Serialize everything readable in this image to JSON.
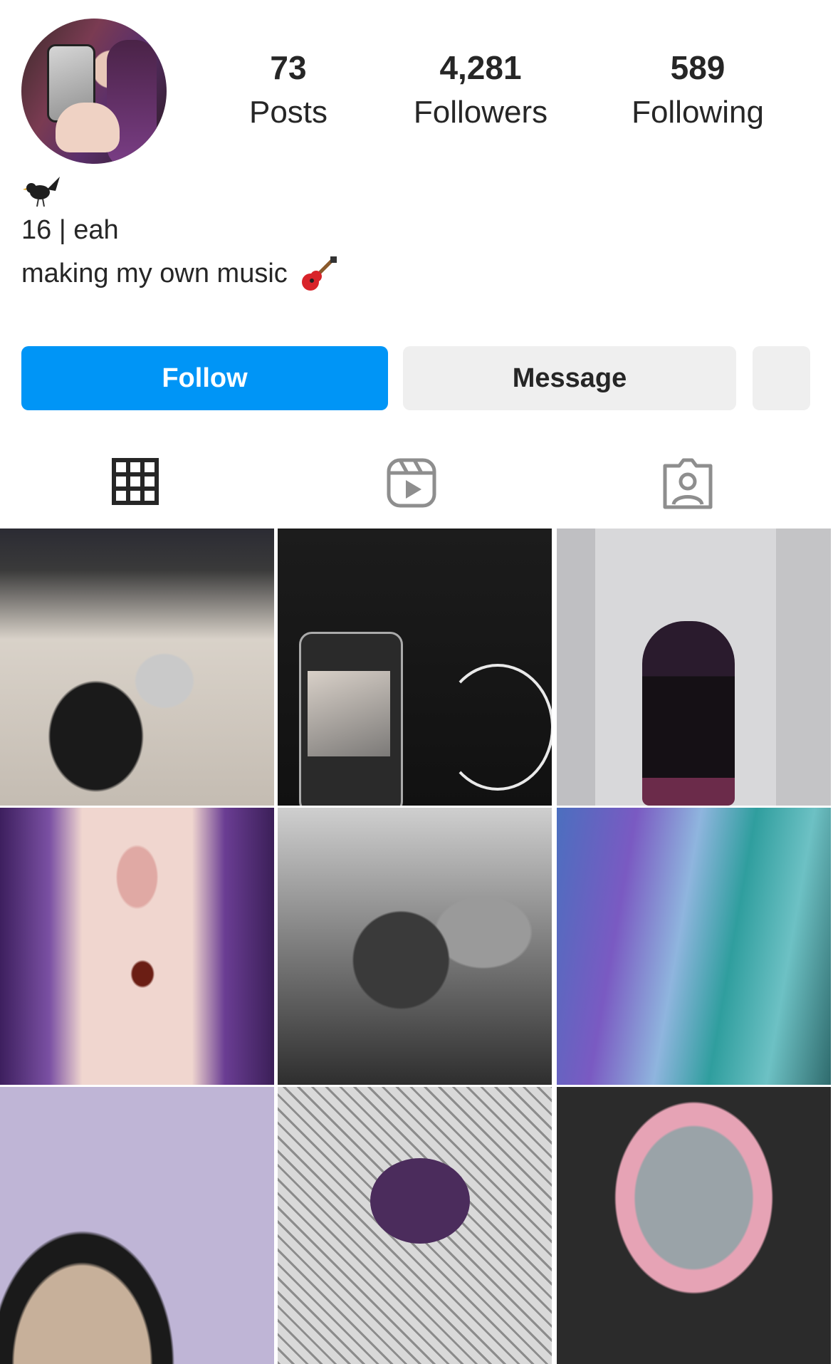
{
  "profile": {
    "stats": {
      "posts": {
        "count": "73",
        "label": "Posts"
      },
      "followers": {
        "count": "4,281",
        "label": "Followers"
      },
      "following": {
        "count": "589",
        "label": "Following"
      }
    },
    "bio": {
      "line1": "16 | eah",
      "line2": "making my own music"
    }
  },
  "actions": {
    "follow_label": "Follow",
    "message_label": "Message"
  },
  "tabs": [
    {
      "name": "grid-icon"
    },
    {
      "name": "reels-icon"
    },
    {
      "name": "tagged-icon"
    }
  ],
  "colors": {
    "accent": "#0095f6",
    "secondary_button": "#efefef",
    "text": "#262626"
  }
}
